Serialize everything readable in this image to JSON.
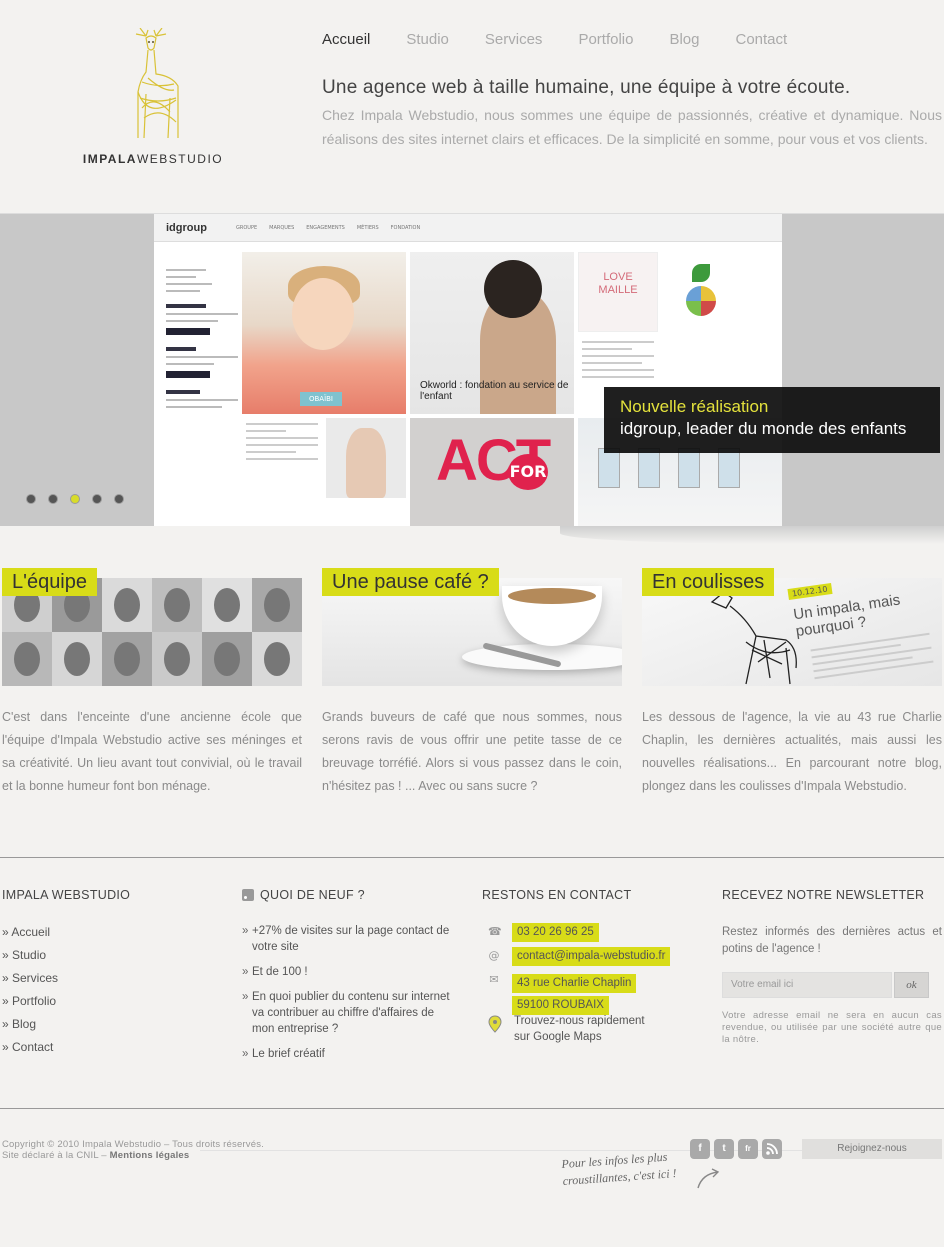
{
  "brand": {
    "name_bold": "IMPALA",
    "name_rest": "WEBSTUDIO"
  },
  "nav": [
    {
      "label": "Accueil",
      "active": true
    },
    {
      "label": "Studio"
    },
    {
      "label": "Services"
    },
    {
      "label": "Portfolio"
    },
    {
      "label": "Blog"
    },
    {
      "label": "Contact"
    }
  ],
  "tagline": {
    "title": "Une agence web à taille humaine, une équipe à votre écoute.",
    "text": "Chez Impala Webstudio, nous sommes une équipe de passionnés, créative et dynamique. Nous réalisons des sites internet clairs et efficaces. De la simplicité en somme, pour vous et vos clients."
  },
  "slider": {
    "mock_logo": "idgroup",
    "mock_nav": [
      "GROUPE",
      "MARQUES",
      "ENGAGEMENTS",
      "MÉTIERS",
      "FONDATION"
    ],
    "mock_badge": "OBAÏBI",
    "mock_tile_caption": "Okworld : fondation au service de l'enfant",
    "mock_lovemaille": "LOVE MAILLE",
    "mock_act": "ACT",
    "mock_for": "FOR",
    "caption_title": "Nouvelle réalisation",
    "caption_text": "idgroup, leader du monde des enfants",
    "slide_count": 5,
    "active_slide": 3
  },
  "features": [
    {
      "label": "L'équipe",
      "text": "C'est dans l'enceinte d'une ancienne école que l'équipe d'Impala Webstudio active ses méninges et sa créativité. Un lieu avant tout convivial, où le travail et la bonne humeur font bon ménage."
    },
    {
      "label": "Une pause café ?",
      "text": "Grands buveurs de café que nous sommes, nous serons ravis de vous offrir une petite tasse de ce breuvage torréfié. Alors si vous passez dans le coin, n'hésitez pas ! ... Avec ou sans sucre ?"
    },
    {
      "label": "En coulisses",
      "image_date": "10.12.10",
      "image_title": "Un impala, mais pourquoi ?",
      "text": "Les dessous de l'agence, la vie au 43 rue Charlie Chaplin, les dernières actualités, mais aussi les nouvelles réalisations... En parcourant notre blog, plongez dans les coulisses d'Impala Webstudio."
    }
  ],
  "footer": {
    "col1": {
      "title": "IMPALA WEBSTUDIO",
      "links": [
        "» Accueil",
        "» Studio",
        "» Services",
        "» Portfolio",
        "» Blog",
        "» Contact"
      ]
    },
    "col2": {
      "title": "QUOI DE NEUF ?",
      "items": [
        "+27% de visites sur la page contact de votre site",
        "Et de 100 !",
        "En quoi publier du contenu sur internet va contribuer au chiffre d'affaires de mon entreprise ?",
        "Le brief créatif"
      ]
    },
    "col3": {
      "title": "RESTONS EN CONTACT",
      "phone": "03 20 26 96 25",
      "email": "contact@impala-webstudio.fr",
      "address1": "43 rue Charlie Chaplin",
      "address2": "59100 ROUBAIX",
      "map_line1": "Trouvez-nous rapidement",
      "map_line2": "sur Google Maps"
    },
    "col4": {
      "title": "RECEVEZ NOTRE NEWSLETTER",
      "intro": "Restez informés des dernières actus et potins de l'agence !",
      "placeholder": "Votre email ici",
      "button": "ok",
      "note": "Votre adresse email ne sera en aucun cas revendue, ou utilisée par une société autre que la nôtre."
    }
  },
  "bottom": {
    "copyright1": "Copyright © 2010 Impala Webstudio – Tous droits réservés.",
    "copyright2": "Site déclaré à la CNIL – ",
    "legal": "Mentions légales",
    "teaser1": "Pour les infos les plus",
    "teaser2": "croustillantes, c'est ici !",
    "socials": [
      "f",
      "t",
      "fr",
      "rss"
    ],
    "join": "Rejoignez-nous"
  },
  "colors": {
    "accent": "#d8dc18",
    "caption_bg": "#0c0c0c",
    "caption_title": "#e4e23c"
  }
}
